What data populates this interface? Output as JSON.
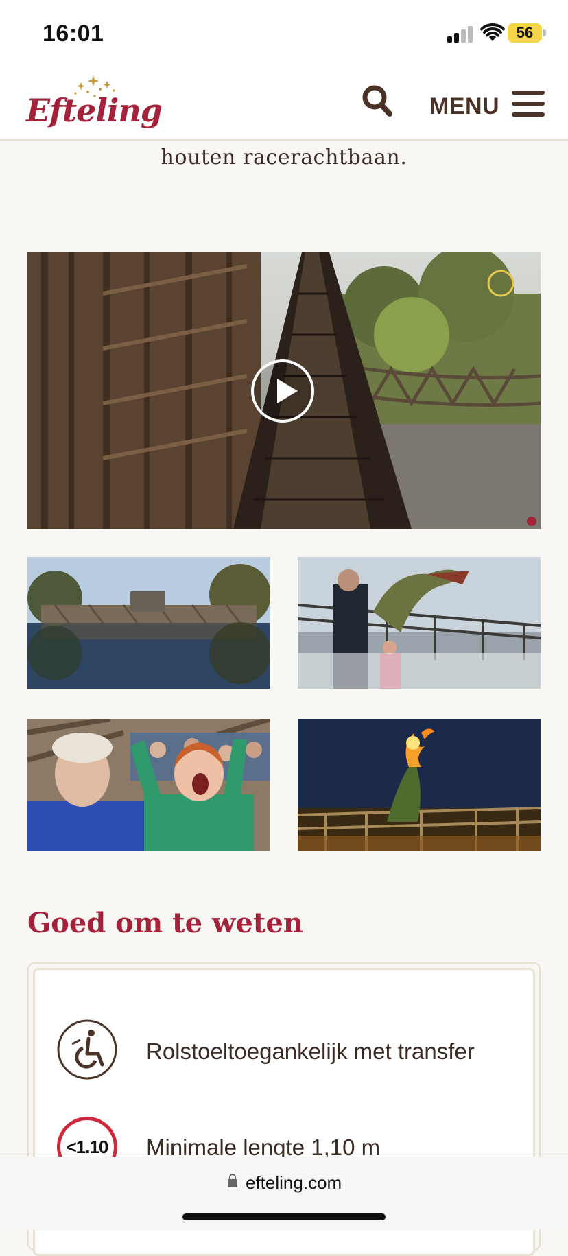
{
  "status_bar": {
    "time": "16:01",
    "battery": "56",
    "battery_color": "#f3d54a"
  },
  "header": {
    "logo_text": "Efteling",
    "menu_label": "MENU",
    "brand_color": "#a4233a"
  },
  "intro": {
    "text": "houten racerachtbaan."
  },
  "media": {
    "video": {
      "icons": [
        "play-icon"
      ]
    },
    "thumbnails": [
      "photo-lake-reflection",
      "photo-dragon-crowd",
      "photo-riders-screaming",
      "photo-fire-dragon-night"
    ]
  },
  "good_to_know": {
    "title": "Goed om te weten",
    "items": [
      {
        "icon": "wheelchair-icon",
        "text": "Rolstoeltoegankelijk met transfer"
      },
      {
        "icon": "height-limit-icon",
        "icon_label": "<1.10",
        "text": "Minimale lengte 1,10 m"
      }
    ]
  },
  "browser": {
    "url": "efteling.com"
  }
}
